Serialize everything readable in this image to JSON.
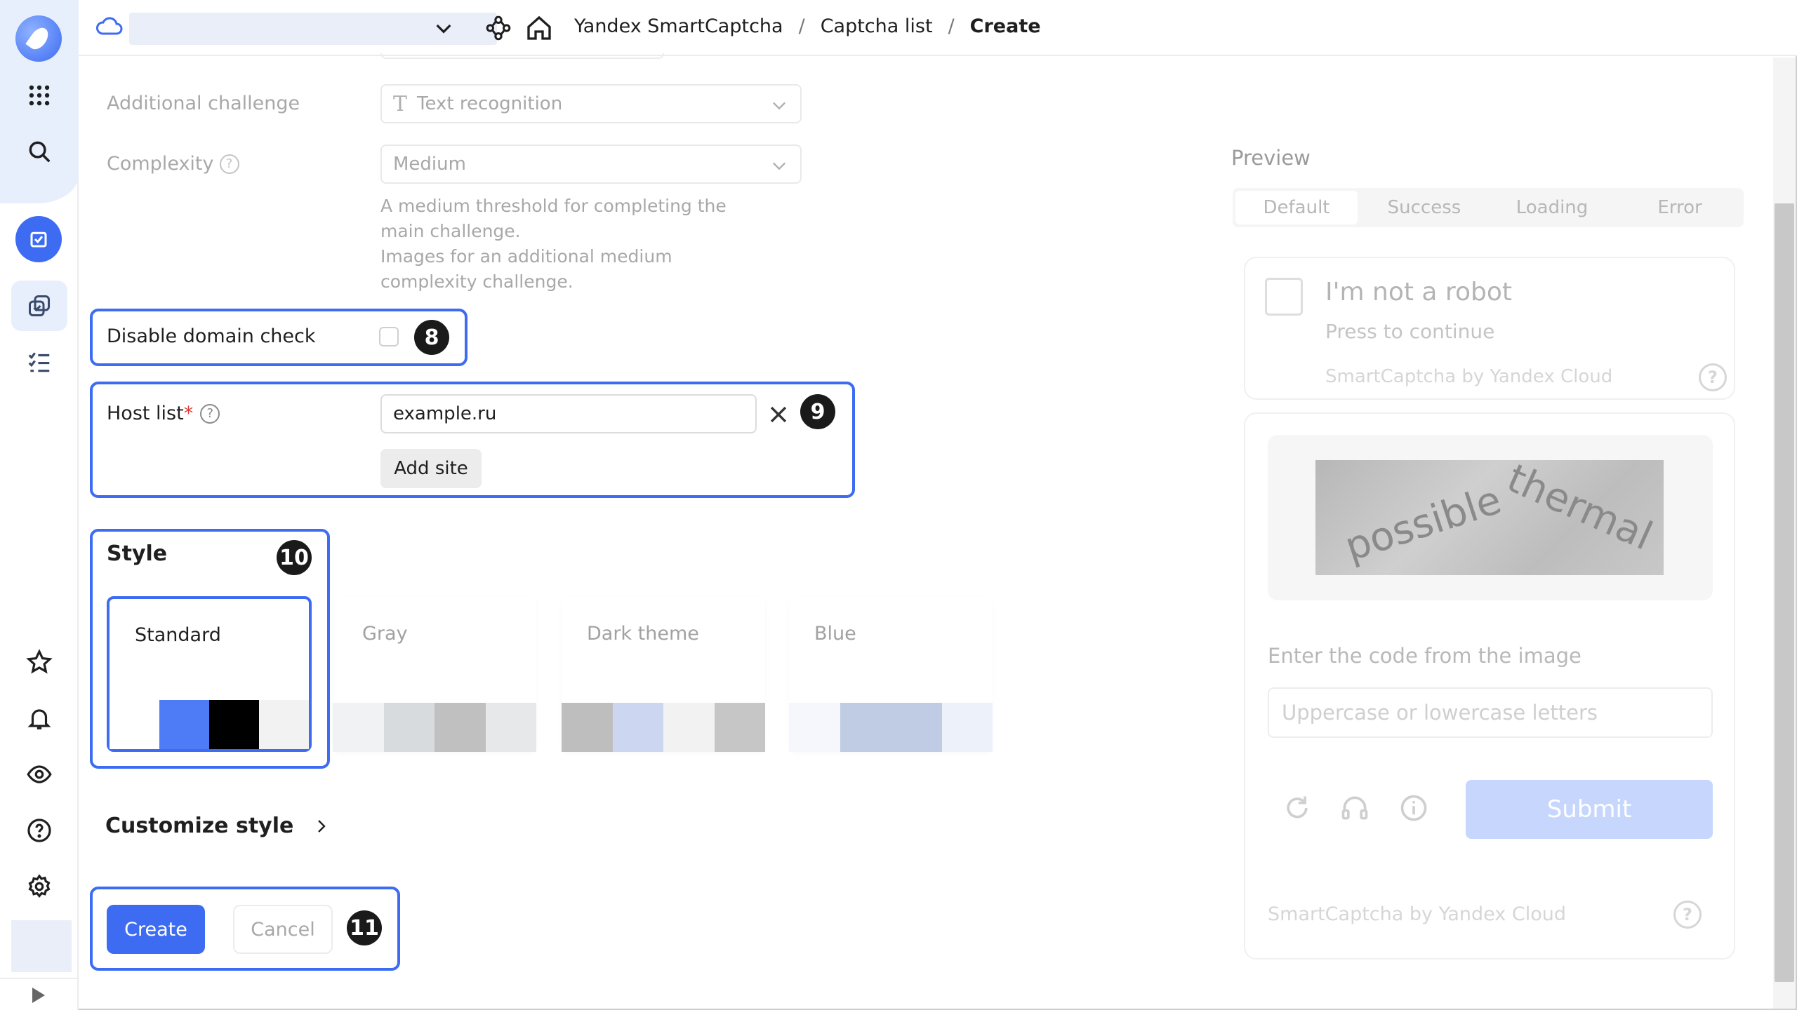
{
  "breadcrumb": {
    "service": "Yandex SmartCaptcha",
    "list": "Captcha list",
    "current": "Create",
    "separator": "/"
  },
  "form": {
    "additional_challenge": {
      "label": "Additional challenge",
      "value": "Text recognition"
    },
    "complexity": {
      "label": "Complexity",
      "value": "Medium",
      "hint_1": "A medium threshold for completing the main challenge.",
      "hint_2": "Images for an additional medium complexity challenge."
    },
    "disable_domain_check": {
      "label": "Disable domain check",
      "checked": false
    },
    "host_list": {
      "label": "Host list",
      "required_mark": "*",
      "value": "example.ru",
      "add_site_label": "Add site"
    },
    "style": {
      "heading": "Style",
      "options": [
        {
          "name": "Standard",
          "selected": true,
          "swatches": [
            "#ffffff",
            "#4d7cf6",
            "#000000",
            "#f2f2f2"
          ]
        },
        {
          "name": "Gray",
          "selected": false,
          "swatches": [
            "#e6e9ec",
            "#b9bec3",
            "#8e8e8e",
            "#d3d6d9"
          ]
        },
        {
          "name": "Dark theme",
          "selected": false,
          "swatches": [
            "#8a8a8a",
            "#a5b6e6",
            "#e9e9e9",
            "#999999"
          ]
        },
        {
          "name": "Blue",
          "selected": false,
          "swatches": [
            "#eef2fb",
            "#8da3cf",
            "#8da3cf",
            "#dde6f7"
          ]
        }
      ]
    },
    "customize_style_label": "Customize style",
    "create_label": "Create",
    "cancel_label": "Cancel"
  },
  "callouts": {
    "c8": "8",
    "c9": "9",
    "c10": "10",
    "c11": "11"
  },
  "preview": {
    "title": "Preview",
    "tabs": [
      "Default",
      "Success",
      "Loading",
      "Error"
    ],
    "active_tab": "Default",
    "widget": {
      "title": "I'm not a robot",
      "subtitle": "Press to continue",
      "footer": "SmartCaptcha by Yandex Cloud",
      "help": "?"
    },
    "challenge": {
      "captcha_word_1": "possible",
      "captcha_word_2": "thermal",
      "enter_label": "Enter the code from the image",
      "input_placeholder": "Uppercase or lowercase letters",
      "submit_label": "Submit",
      "footer": "SmartCaptcha by Yandex Cloud",
      "help": "?"
    }
  },
  "icons": {
    "sidebar": [
      "logo-icon",
      "apps-grid-icon",
      "search-icon",
      "smartcaptcha-icon",
      "captcha-list-icon",
      "checklist-icon",
      "star-icon",
      "bell-icon",
      "eye-icon",
      "help-icon",
      "gear-icon",
      "expand-icon"
    ],
    "topbar": [
      "cloud-icon",
      "chevron-down-icon",
      "nodes-icon",
      "home-icon"
    ]
  },
  "colors": {
    "accent": "#3d6cf2",
    "callout_border": "#3d6cf2",
    "badge": "#1a1a1a",
    "required": "#e23b3b"
  }
}
